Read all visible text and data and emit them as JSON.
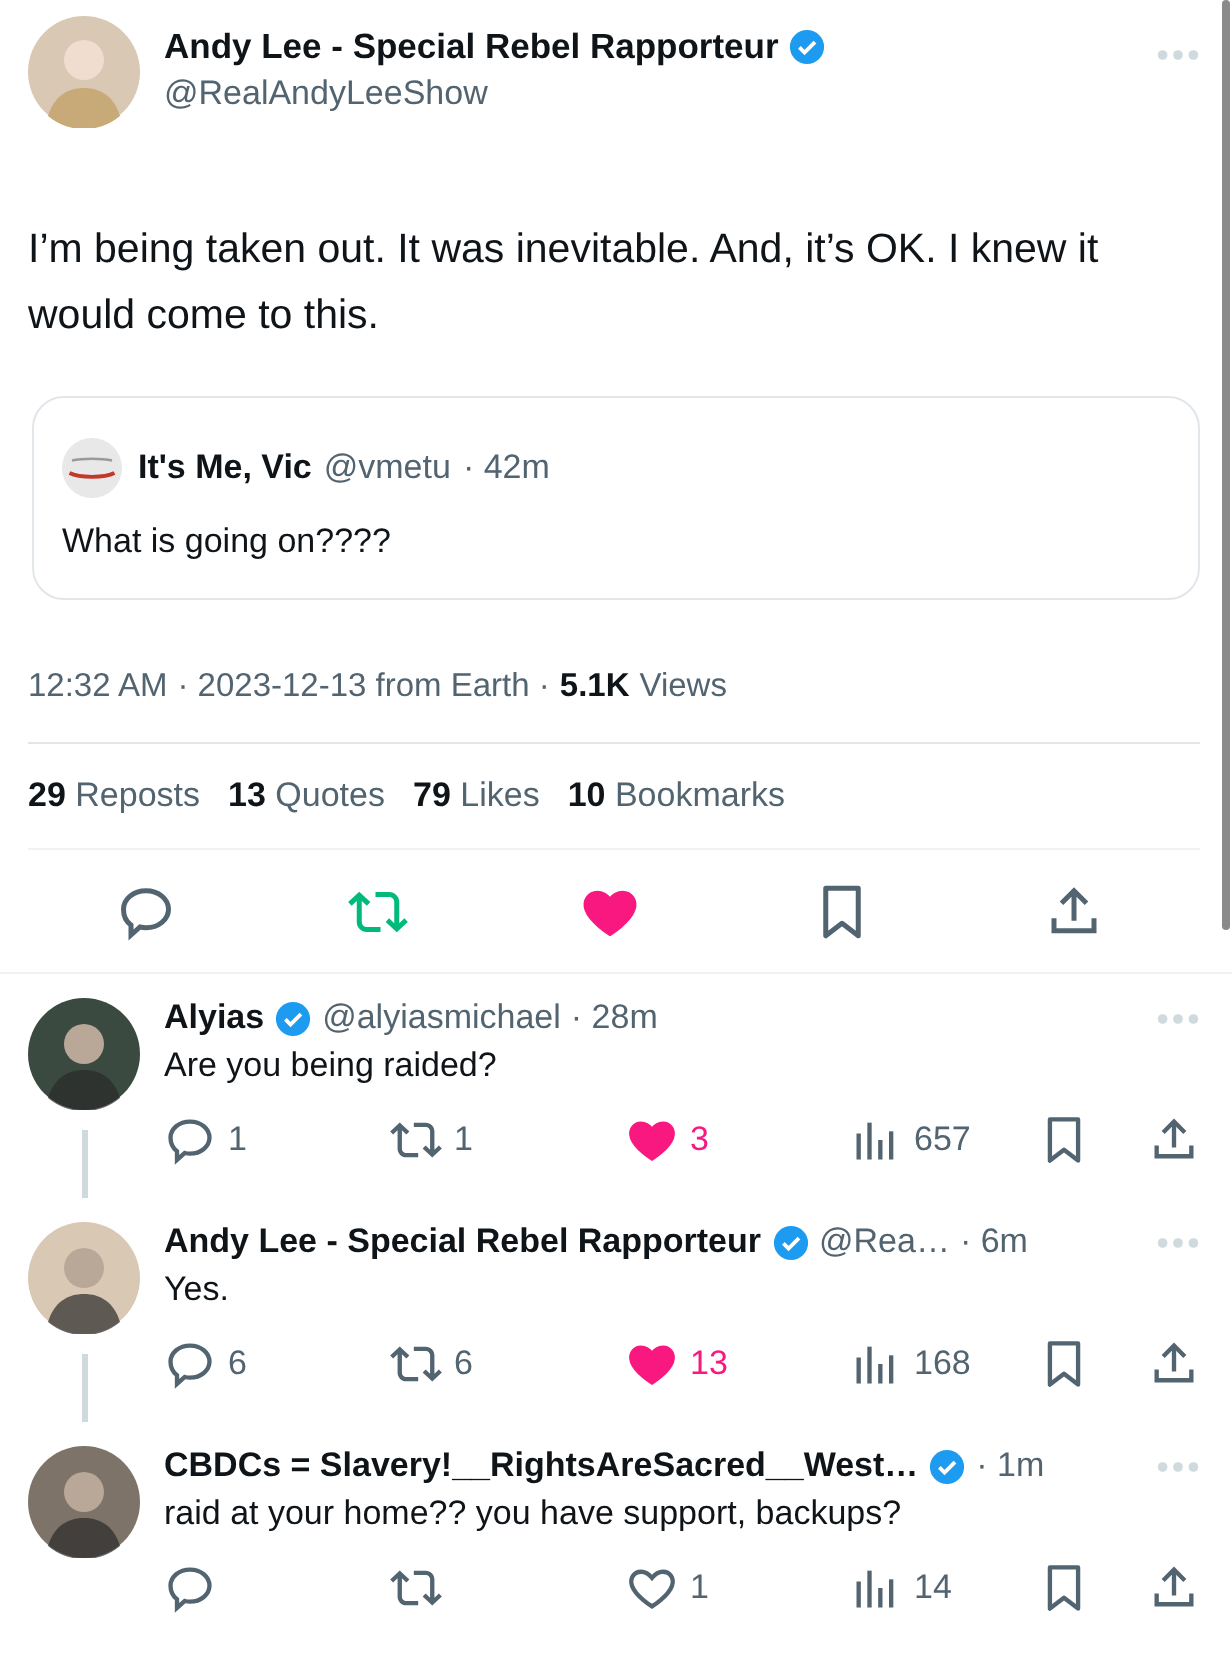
{
  "tweet": {
    "author": {
      "name": "Andy Lee - Special Rebel Rapporteur",
      "verified": true,
      "handle": "@RealAndyLeeShow"
    },
    "text": "I’m being taken out. It was inevitable. And, it’s OK. I knew it would come to this.",
    "quote": {
      "name": "It's Me, Vic",
      "handle": "@vmetu",
      "time": "· 42m",
      "text": "What is going on????"
    },
    "meta": {
      "time": "12:32 AM",
      "date": "· 2023-12-13 from Earth ·",
      "views_count": "5.1K",
      "views_label": "Views"
    },
    "stats": [
      {
        "count": "29",
        "label": "Reposts"
      },
      {
        "count": "13",
        "label": "Quotes"
      },
      {
        "count": "79",
        "label": "Likes"
      },
      {
        "count": "10",
        "label": "Bookmarks"
      }
    ],
    "reposted": true,
    "liked": true
  },
  "replies": [
    {
      "name": "Alyias",
      "verified": true,
      "handle": "@alyiasmichael",
      "time": "· 28m",
      "text": "Are you being raided?",
      "replies": "1",
      "reposts": "1",
      "likes": "3",
      "liked": true,
      "views": "657",
      "connected_below": true
    },
    {
      "name": "Andy Lee - Special Rebel Rapporteur",
      "verified": true,
      "handle": "@Rea…",
      "time": "· 6m",
      "text": "Yes.",
      "replies": "6",
      "reposts": "6",
      "likes": "13",
      "liked": true,
      "views": "168",
      "connected_below": true
    },
    {
      "name": "CBDCs = Slavery!__RightsAreSacred__West…",
      "verified": true,
      "time": "· 1m",
      "text": "raid at your home?? you have support, backups?",
      "likes": "1",
      "liked": false,
      "views": "14",
      "connected_below": false
    }
  ]
}
